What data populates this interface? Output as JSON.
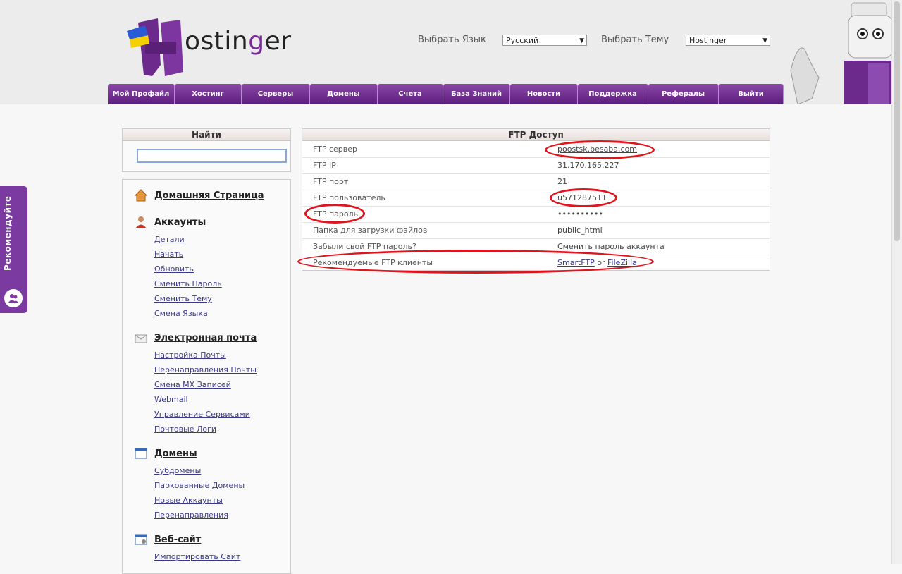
{
  "header": {
    "logo_text": "Hostinger",
    "language_label": "Выбрать Язык",
    "language_value": "Русский",
    "theme_label": "Выбрать Тему",
    "theme_value": "Hostinger"
  },
  "nav": [
    "Мой Профайл",
    "Хостинг",
    "Серверы",
    "Домены",
    "Счета",
    "База Знаний",
    "Новости",
    "Поддержка",
    "Рефералы",
    "Выйти"
  ],
  "recommend": "Рекомендуйте",
  "search": {
    "title": "Найти",
    "value": ""
  },
  "sidebar": {
    "home": "Домашняя Страница",
    "accounts": {
      "title": "Аккаунты",
      "links": [
        "Детали",
        "Начать",
        "Обновить",
        "Сменить Пароль",
        "Сменить Тему",
        "Смена Языка"
      ]
    },
    "email": {
      "title": "Электронная почта",
      "links": [
        "Настройка Почты",
        "Перенаправления Почты",
        "Смена MX Записей",
        "Webmail",
        "Управление Сервисами",
        "Почтовые Логи"
      ]
    },
    "domains": {
      "title": "Домены",
      "links": [
        "Субдомены",
        "Паркованные Домены",
        "Новые Аккаунты",
        "Перенаправления"
      ]
    },
    "website": {
      "title": "Веб-сайт",
      "links": [
        "Импортировать Сайт"
      ]
    }
  },
  "ftp": {
    "title": "FTP Доступ",
    "rows": [
      {
        "key": "FTP сервер",
        "value": "poostsk.besaba.com"
      },
      {
        "key": "FTP IP",
        "value": "31.170.165.227"
      },
      {
        "key": "FTP порт",
        "value": "21"
      },
      {
        "key": "FTP пользователь",
        "value": "u571287511"
      },
      {
        "key": "FTP пароль",
        "value": "••••••••••"
      },
      {
        "key": "Папка для загрузки файлов",
        "value": "public_html"
      },
      {
        "key": "Забыли свой FTP пароль?",
        "value": "Сменить пароль аккаунта"
      },
      {
        "key": "Рекомендуемые FTP клиенты",
        "value_a": "SmartFTP",
        "value_or": "or",
        "value_b": "FileZilla"
      }
    ]
  },
  "colors": {
    "brand_purple": "#6b2a8c",
    "highlight_red": "#e0141e"
  }
}
